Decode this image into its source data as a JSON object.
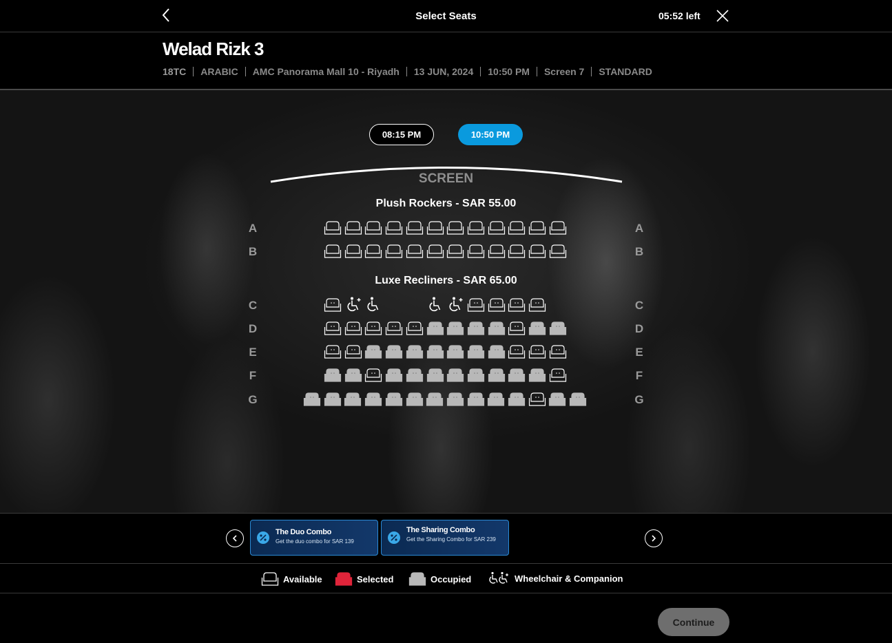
{
  "header": {
    "title": "Select Seats",
    "timer": "05:52 left"
  },
  "movie": {
    "title": "Welad Rizk 3",
    "rating": "18TC",
    "language": "ARABIC",
    "cinema": "AMC Panorama Mall 10 - Riyadh",
    "date": "13 JUN, 2024",
    "time": "10:50 PM",
    "screen": "Screen 7",
    "format": "STANDARD"
  },
  "showtimes": [
    {
      "label": "08:15 PM",
      "selected": false
    },
    {
      "label": "10:50 PM",
      "selected": true
    }
  ],
  "screen_label": "SCREEN",
  "sections": [
    {
      "name": "Plush Rockers -",
      "currency": "SAR",
      "price": "55.00"
    },
    {
      "name": "Luxe Recliners -",
      "currency": "SAR",
      "price": "65.00"
    }
  ],
  "rows": {
    "A": "A",
    "B": "B",
    "C": "C",
    "D": "D",
    "E": "E",
    "F": "F",
    "G": "G"
  },
  "seat_map": {
    "A": [
      "rocker",
      "rocker",
      "rocker",
      "rocker",
      "rocker",
      "rocker",
      "rocker",
      "rocker",
      "rocker",
      "rocker",
      "rocker",
      "rocker"
    ],
    "B": [
      "rocker",
      "rocker",
      "rocker",
      "rocker",
      "rocker",
      "rocker",
      "rocker",
      "rocker",
      "rocker",
      "rocker",
      "rocker",
      "rocker"
    ],
    "C": [
      "available",
      "wheelchair-companion",
      "wheelchair",
      "gap",
      "gap",
      "wheelchair",
      "wheelchair-companion",
      "available",
      "available",
      "available",
      "available"
    ],
    "D": [
      "available",
      "available",
      "available",
      "available",
      "available",
      "occupied",
      "occupied",
      "occupied",
      "occupied",
      "available",
      "occupied",
      "occupied"
    ],
    "E": [
      "available",
      "available",
      "occupied",
      "occupied",
      "occupied",
      "occupied",
      "occupied",
      "occupied",
      "occupied",
      "available",
      "available",
      "available"
    ],
    "F": [
      "occupied",
      "occupied",
      "available",
      "occupied",
      "occupied",
      "occupied",
      "occupied",
      "occupied",
      "occupied",
      "occupied",
      "occupied",
      "available"
    ],
    "G": [
      "occupied",
      "occupied",
      "occupied",
      "occupied",
      "occupied",
      "occupied",
      "occupied",
      "occupied",
      "occupied",
      "occupied",
      "occupied",
      "available",
      "occupied",
      "occupied"
    ]
  },
  "combos": [
    {
      "name": "The Duo Combo",
      "desc": "Get the duo combo for SAR 139",
      "icon": "percent-icon"
    },
    {
      "name": "The Sharing Combo",
      "desc": "Get the Sharing Combo for SAR 239",
      "icon": "percent-icon"
    }
  ],
  "legend": {
    "available": "Available",
    "selected": "Selected",
    "occupied": "Occupied",
    "wheelchair": "Wheelchair & Companion"
  },
  "colors": {
    "accent": "#0a9ade",
    "selected_seat": "#e0243a",
    "occupied_seat": "#b8b8b8",
    "combo_border": "#2a8ad6"
  },
  "continue_label": "Continue"
}
